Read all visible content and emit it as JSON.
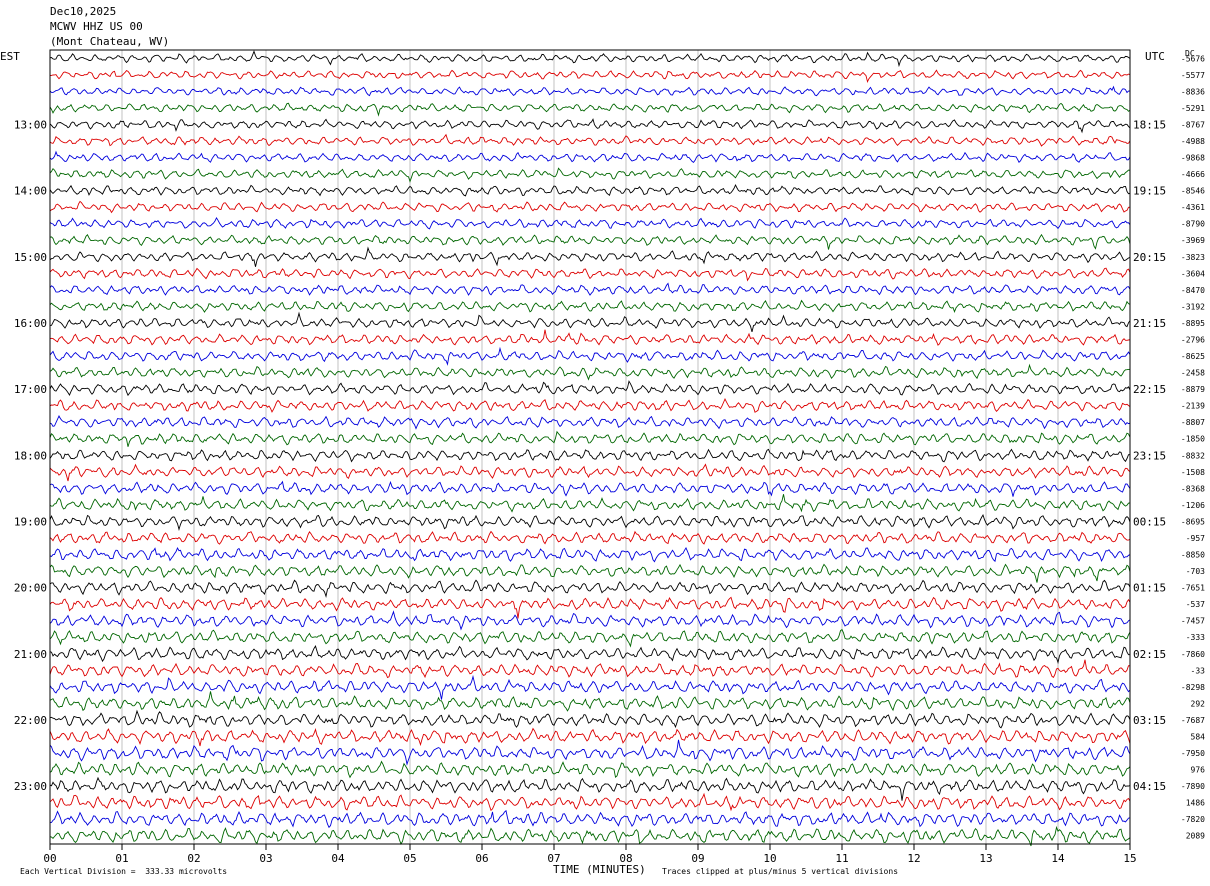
{
  "header": {
    "date": "Dec10,2025",
    "station": "MCWV HHZ US 00",
    "location": "(Mont Chateau, WV)"
  },
  "labels": {
    "left_zone": "EST",
    "right_zone": "UTC",
    "dc_label": "DC",
    "x_title": "TIME (MINUTES)",
    "scale_note": "Each Vertical Division =  333.33 microvolts",
    "clip_note": "Traces clipped at plus/minus 5 vertical divisions"
  },
  "colors": {
    "trace_cycle": [
      "#000000",
      "#dd0000",
      "#0000dd",
      "#006600"
    ],
    "axis": "#000000",
    "grid": "#9a9a9a"
  },
  "chart_data": {
    "type": "line",
    "subtype": "helicorder",
    "xlim": [
      0,
      15
    ],
    "x_ticks": [
      "00",
      "01",
      "02",
      "03",
      "04",
      "05",
      "06",
      "07",
      "08",
      "09",
      "10",
      "11",
      "12",
      "13",
      "14",
      "15"
    ],
    "rows_per_hour": 4,
    "row_count": 48,
    "hours_left": [
      "13:00",
      "14:00",
      "15:00",
      "16:00",
      "17:00",
      "18:00",
      "19:00",
      "20:00",
      "21:00",
      "22:00",
      "23:00"
    ],
    "hours_right": [
      "18:15",
      "19:15",
      "20:15",
      "21:15",
      "22:15",
      "23:15",
      "00:15",
      "01:15",
      "02:15",
      "03:15",
      "04:15"
    ],
    "first_labeled_row": 4,
    "dc_offsets": [
      "-5676",
      "-5577",
      "-8836",
      "-5291",
      "-8767",
      "-4988",
      "-9868",
      "-4666",
      "-8546",
      "-4361",
      "-8790",
      "-3969",
      "-3823",
      "-3604",
      "-8470",
      "-3192",
      "-8895",
      "-2796",
      "-8625",
      "-2458",
      "-8879",
      "-2139",
      "-8807",
      "-1850",
      "-8832",
      "-1508",
      "-8368",
      "-1206",
      "-8695",
      "-957",
      "-8850",
      "-703",
      "-7651",
      "-537",
      "-7457",
      "-333",
      "-7860",
      "-33",
      "-8298",
      "292",
      "-7687",
      "584",
      "-7950",
      "976",
      "-7890",
      "1486",
      "-7820",
      "2089"
    ]
  }
}
